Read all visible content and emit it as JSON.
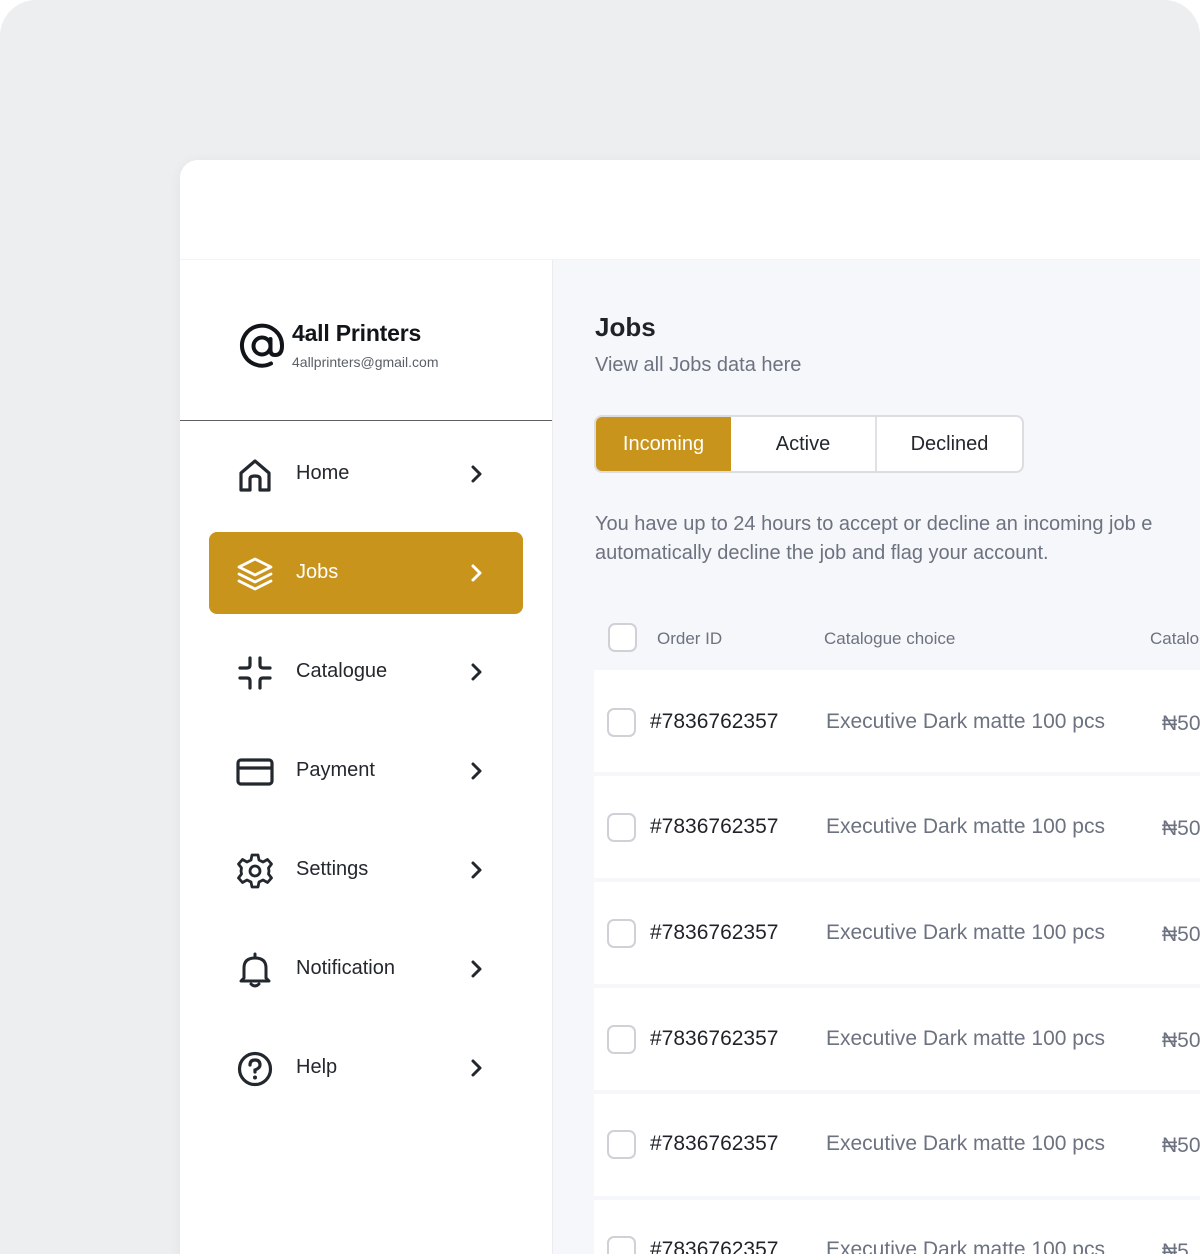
{
  "brand": {
    "name": "4all Printers",
    "email": "4allprinters@gmail.com",
    "logo_icon": "at-sign-icon"
  },
  "sidebar": {
    "items": [
      {
        "label": "Home",
        "icon": "home-icon",
        "active": false
      },
      {
        "label": "Jobs",
        "icon": "layers-icon",
        "active": true
      },
      {
        "label": "Catalogue",
        "icon": "minimize-icon",
        "active": false
      },
      {
        "label": "Payment",
        "icon": "credit-card-icon",
        "active": false
      },
      {
        "label": "Settings",
        "icon": "gear-icon",
        "active": false
      },
      {
        "label": "Notification",
        "icon": "bell-icon",
        "active": false
      },
      {
        "label": "Help",
        "icon": "help-circle-icon",
        "active": false
      }
    ]
  },
  "main": {
    "title": "Jobs",
    "subtitle": "View all Jobs data here",
    "tabs": [
      {
        "label": "Incoming",
        "active": true
      },
      {
        "label": "Active",
        "active": false
      },
      {
        "label": "Declined",
        "active": false
      }
    ],
    "info_line1": "You have up to 24 hours to accept or decline an incoming job e",
    "info_line2": "automatically decline the job and flag your account."
  },
  "table": {
    "headers": {
      "order_id": "Order ID",
      "catalogue_choice": "Catalogue choice",
      "catalogue_price": "Catalo"
    },
    "rows": [
      {
        "order_id": "#7836762357",
        "catalogue_choice": "Executive Dark matte 100 pcs",
        "price": "₦50"
      },
      {
        "order_id": "#7836762357",
        "catalogue_choice": "Executive Dark matte 100 pcs",
        "price": "₦50"
      },
      {
        "order_id": "#7836762357",
        "catalogue_choice": "Executive Dark matte 100 pcs",
        "price": "₦50"
      },
      {
        "order_id": "#7836762357",
        "catalogue_choice": "Executive Dark matte 100 pcs",
        "price": "₦50"
      },
      {
        "order_id": "#7836762357",
        "catalogue_choice": "Executive Dark matte 100 pcs",
        "price": "₦50"
      },
      {
        "order_id": "#7836762357",
        "catalogue_choice": "Executive Dark matte 100 pcs",
        "price": "₦5"
      }
    ]
  },
  "colors": {
    "accent": "#c9941b",
    "text_dark": "#1f2329",
    "text_muted": "#6c7280",
    "main_bg": "#f6f7fa"
  }
}
